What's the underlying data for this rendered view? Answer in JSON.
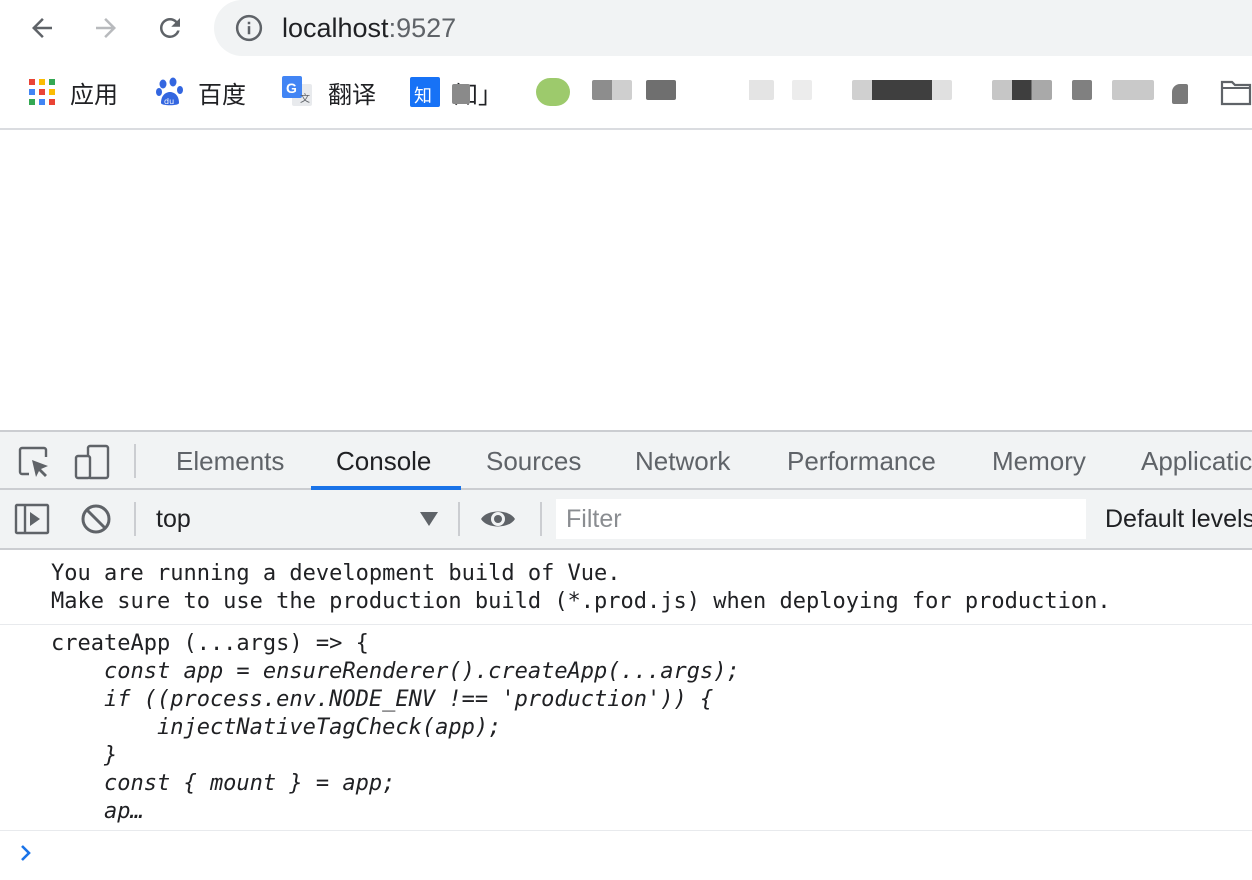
{
  "toolbar": {
    "back_icon": "arrow-left-icon",
    "forward_icon": "arrow-right-icon",
    "reload_icon": "reload-icon",
    "info_icon": "info-icon",
    "url_host": "localhost",
    "url_port": ":9527"
  },
  "bookmarks": {
    "items": [
      {
        "label": "应用",
        "icon": "apps-grid-icon"
      },
      {
        "label": "百度",
        "icon": "baidu-paw-icon"
      },
      {
        "label": "翻译",
        "icon": "google-translate-icon"
      },
      {
        "label": "知」",
        "icon": "zhihu-icon"
      }
    ],
    "folder_icon": "folder-icon"
  },
  "devtools": {
    "tabs": [
      "Elements",
      "Console",
      "Sources",
      "Network",
      "Performance",
      "Memory",
      "Applicatic"
    ],
    "active_tab": "Console",
    "context": "top",
    "filter_placeholder": "Filter",
    "levels_label": "Default levels",
    "accent_color": "#1a73e8"
  },
  "console": {
    "message1": [
      "You are running a development build of Vue.",
      "Make sure to use the production build (*.prod.js) when deploying for production."
    ],
    "message2": [
      "createApp (...args) => {",
      "    const app = ensureRenderer().createApp(...args);",
      "    if ((process.env.NODE_ENV !== 'production')) {",
      "        injectNativeTagCheck(app);",
      "    }",
      "    const { mount } = app;",
      "    ap…"
    ]
  }
}
